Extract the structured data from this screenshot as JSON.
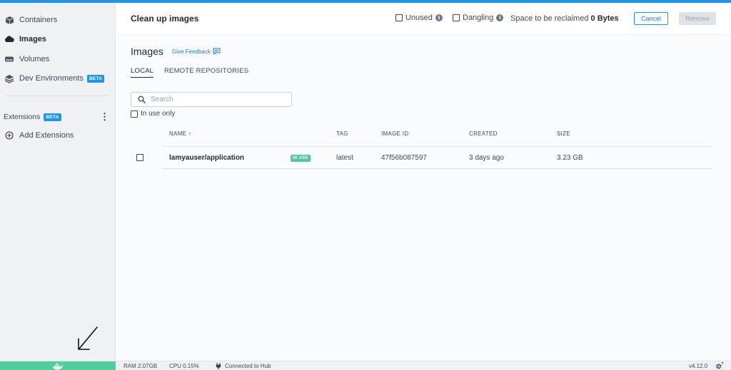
{
  "sidebar": {
    "items": [
      {
        "label": "Containers",
        "icon": "containers-icon"
      },
      {
        "label": "Images",
        "icon": "images-icon"
      },
      {
        "label": "Volumes",
        "icon": "volumes-icon"
      },
      {
        "label": "Dev Environments",
        "icon": "dev-environments-icon",
        "badge": "BETA"
      }
    ],
    "extensions": {
      "label": "Extensions",
      "badge": "BETA"
    },
    "add_extensions": "Add Extensions"
  },
  "header": {
    "title": "Clean up images",
    "unused_label": "Unused",
    "dangling_label": "Dangling",
    "reclaim_label": "Space to be reclaimed",
    "reclaim_value": "0 Bytes",
    "cancel_label": "Cancel",
    "remove_label": "Remove"
  },
  "main": {
    "title": "Images",
    "feedback_label": "Give Feedback",
    "tabs": [
      {
        "label": "LOCAL",
        "active": true
      },
      {
        "label": "REMOTE REPOSITORIES",
        "active": false
      }
    ],
    "search": {
      "placeholder": "Search"
    },
    "in_use_only_label": "In use only",
    "table": {
      "columns": [
        "NAME ↑",
        "TAG",
        "IMAGE ID",
        "CREATED",
        "SIZE"
      ],
      "rows": [
        {
          "name": "lamyauser/application",
          "badge": "IN USE",
          "tag": "latest",
          "image_id": "47f56b087597",
          "created": "3 days ago",
          "size": "3.23 GB"
        }
      ]
    }
  },
  "footer": {
    "ram": "RAM 2.07GB",
    "cpu": "CPU 0.15%",
    "hub": "Connected to Hub",
    "version": "v4.12.0"
  },
  "colors": {
    "accent": "#1d96f3",
    "whale_bar": "#4fcf9c",
    "in_use_badge": "#4cc9a0"
  }
}
